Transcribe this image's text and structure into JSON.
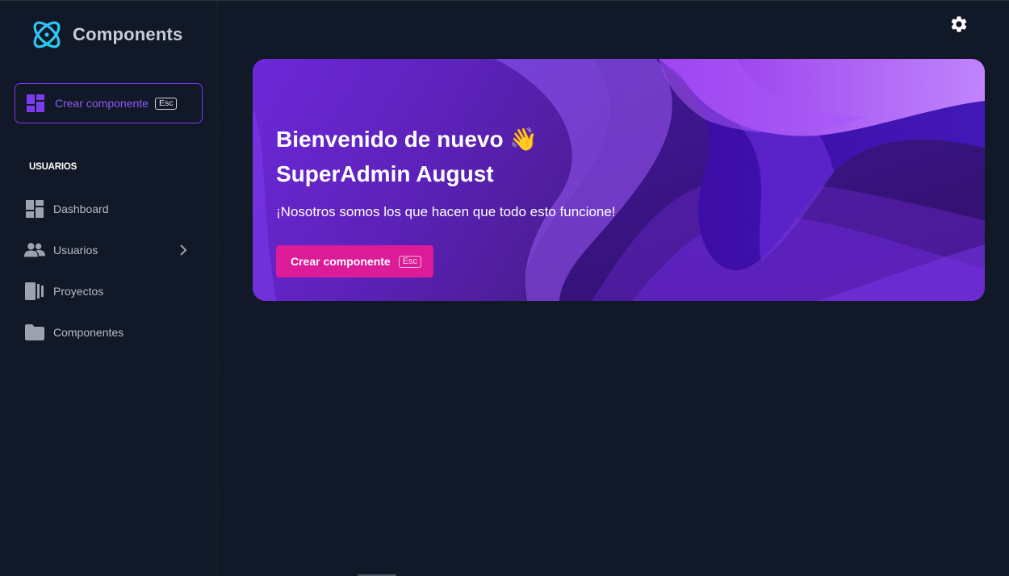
{
  "app": {
    "name": "Components"
  },
  "sidebar": {
    "create_button": {
      "label": "Crear componente",
      "shortcut": "Esc",
      "icon": "dashboard-icon"
    },
    "section_title": "USUARIOS",
    "items": [
      {
        "label": "Dashboard",
        "icon": "dashboard-icon"
      },
      {
        "label": "Usuarios",
        "icon": "users-icon",
        "has_submenu": true
      },
      {
        "label": "Proyectos",
        "icon": "projects-icon"
      },
      {
        "label": "Componentes",
        "icon": "folder-icon"
      }
    ]
  },
  "header": {
    "settings_icon": "gear-icon"
  },
  "banner": {
    "greeting": "Bienvenido de nuevo",
    "wave_emoji": "👋",
    "user_name": "SuperAdmin August",
    "subtitle": "¡Nosotros somos los que hacen que todo esto funcione!",
    "button_label": "Crear componente",
    "button_shortcut": "Esc"
  },
  "colors": {
    "background": "#111827",
    "accent_purple": "#7c3aed",
    "button_pink": "#db1b97"
  }
}
